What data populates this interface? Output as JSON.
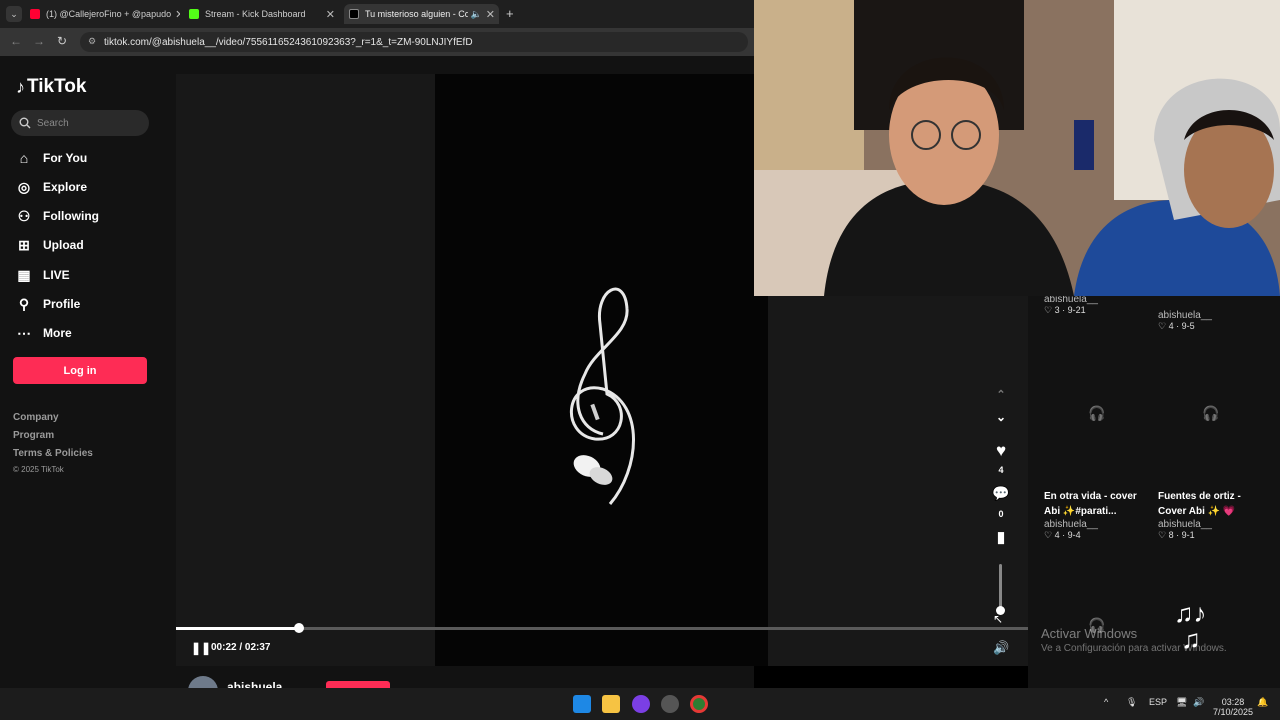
{
  "browser": {
    "tabs": [
      {
        "title": "(1) @CallejeroFino + @papudo",
        "favicon_color": "#ff0033"
      },
      {
        "title": "Stream - Kick Dashboard",
        "favicon_color": "#53fc18"
      },
      {
        "title": "Tu misterioso alguien - Cov",
        "favicon_color": "#000000"
      }
    ],
    "new_tab": "+",
    "url": "tiktok.com/@abishuela__/video/7556116524361092363?_r=1&_t=ZM-90LNJIYfEfD"
  },
  "tiktok": {
    "logo_text": "TikTok",
    "search_placeholder": "Search",
    "nav": [
      {
        "label": "For You",
        "icon": "home-icon"
      },
      {
        "label": "Explore",
        "icon": "compass-icon"
      },
      {
        "label": "Following",
        "icon": "following-icon"
      },
      {
        "label": "Upload",
        "icon": "upload-icon"
      },
      {
        "label": "LIVE",
        "icon": "live-icon"
      },
      {
        "label": "Profile",
        "icon": "profile-icon"
      },
      {
        "label": "More",
        "icon": "more-icon"
      }
    ],
    "login_label": "Log in",
    "footer": [
      "Company",
      "Program",
      "Terms & Policies"
    ],
    "copyright": "© 2025 TikTok",
    "player": {
      "time": "00:22 / 02:37",
      "progress": 0.144,
      "likes": "4",
      "comments": "0",
      "author": "abishuela"
    },
    "thumbs": [
      {
        "user": "abishuela__",
        "stat": "3 · 9-21"
      },
      {
        "user": "abishuela__",
        "stat": "4 · 9-5"
      },
      {
        "title": "En otra vida - cover Abi ✨#parati...",
        "user": "abishuela__",
        "stat": "4 · 9-4"
      },
      {
        "title": "Fuentes de ortiz - Cover Abi ✨ 💗",
        "user": "abishuela__",
        "stat": "8 · 9-1"
      }
    ]
  },
  "watermark": {
    "line1": "Activar Windows",
    "line2": "Ve a Configuración para activar Windows."
  },
  "taskbar": {
    "lang": "ESP",
    "time": "03:28",
    "date": "7/10/2025"
  }
}
